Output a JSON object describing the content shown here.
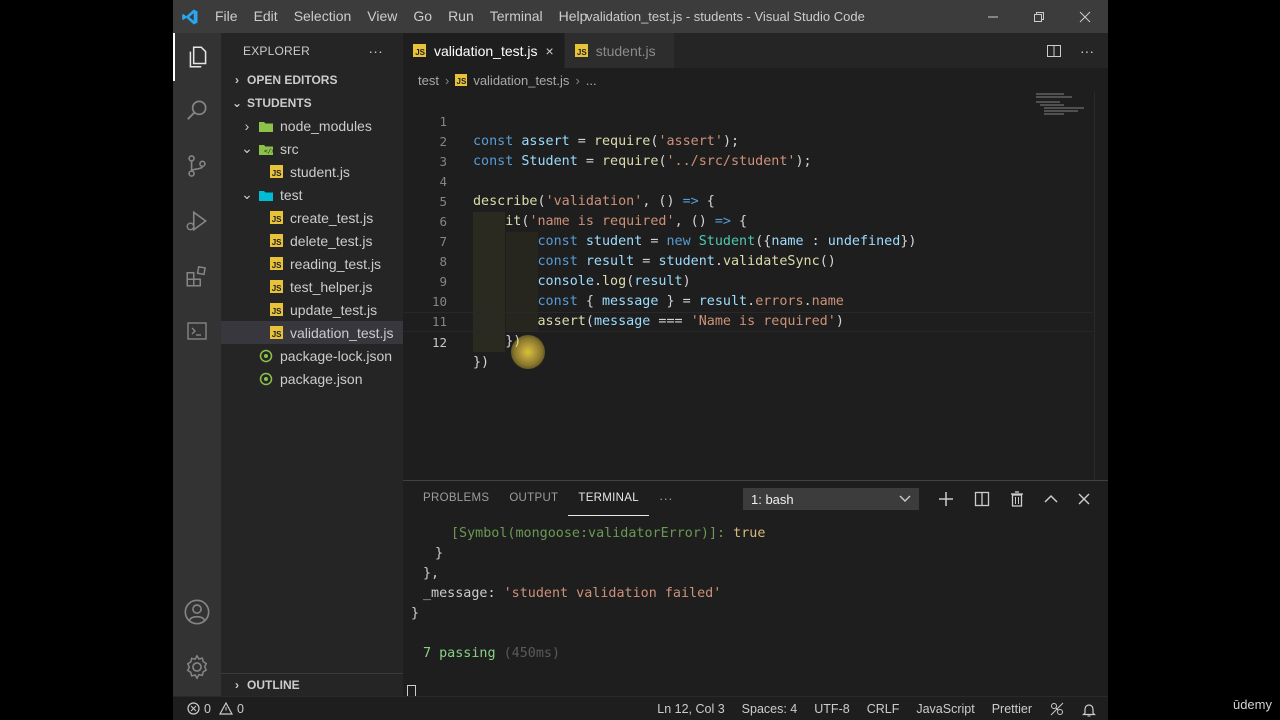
{
  "titlebar": {
    "menus": [
      "File",
      "Edit",
      "Selection",
      "View",
      "Go",
      "Run",
      "Terminal",
      "Help"
    ],
    "window_title": "validation_test.js - students - Visual Studio Code"
  },
  "sidebar": {
    "title": "EXPLORER",
    "more": "···",
    "open_editors": "OPEN EDITORS",
    "workspace": "STUDENTS",
    "outline": "OUTLINE",
    "tree": [
      {
        "label": "node_modules",
        "type": "folder",
        "expanded": false,
        "depth": 1
      },
      {
        "label": "src",
        "type": "folder",
        "expanded": true,
        "depth": 1
      },
      {
        "label": "student.js",
        "type": "js",
        "depth": 2
      },
      {
        "label": "test",
        "type": "folder",
        "expanded": true,
        "depth": 1
      },
      {
        "label": "create_test.js",
        "type": "js",
        "depth": 2
      },
      {
        "label": "delete_test.js",
        "type": "js",
        "depth": 2
      },
      {
        "label": "reading_test.js",
        "type": "js",
        "depth": 2
      },
      {
        "label": "test_helper.js",
        "type": "js",
        "depth": 2
      },
      {
        "label": "update_test.js",
        "type": "js",
        "depth": 2
      },
      {
        "label": "validation_test.js",
        "type": "js",
        "depth": 2,
        "selected": true
      },
      {
        "label": "package-lock.json",
        "type": "json",
        "depth": 1
      },
      {
        "label": "package.json",
        "type": "json",
        "depth": 1
      }
    ]
  },
  "editor": {
    "tabs": [
      {
        "label": "validation_test.js",
        "active": true
      },
      {
        "label": "student.js",
        "active": false
      }
    ],
    "close_glyph": "×",
    "breadcrumb": {
      "folder": "test",
      "file": "validation_test.js",
      "more": "..."
    },
    "line_numbers": [
      "1",
      "2",
      "3",
      "4",
      "5",
      "6",
      "7",
      "8",
      "9",
      "10",
      "11",
      "12"
    ],
    "current_line": 12
  },
  "panel": {
    "tabs": [
      "PROBLEMS",
      "OUTPUT",
      "TERMINAL"
    ],
    "more": "···",
    "active_tab": "TERMINAL",
    "terminal_select": "1: bash",
    "terminal_lines": [
      "[Symbol(mongoose:validatorError)]: true",
      "}",
      "},",
      "_message: 'student validation failed'",
      "}",
      "7 passing (450ms)"
    ]
  },
  "statusbar": {
    "errors": "0",
    "warnings": "0",
    "position": "Ln 12, Col 3",
    "spaces": "Spaces: 4",
    "encoding": "UTF-8",
    "eol": "CRLF",
    "language": "JavaScript",
    "formatter": "Prettier"
  },
  "watermark": "ūdemy",
  "colors": {
    "accent": "#007acc",
    "js_icon": "#e8c33a",
    "folder_src": "#8bc34a",
    "folder_test": "#00bcd4",
    "json_icon": "#8bc34a"
  }
}
